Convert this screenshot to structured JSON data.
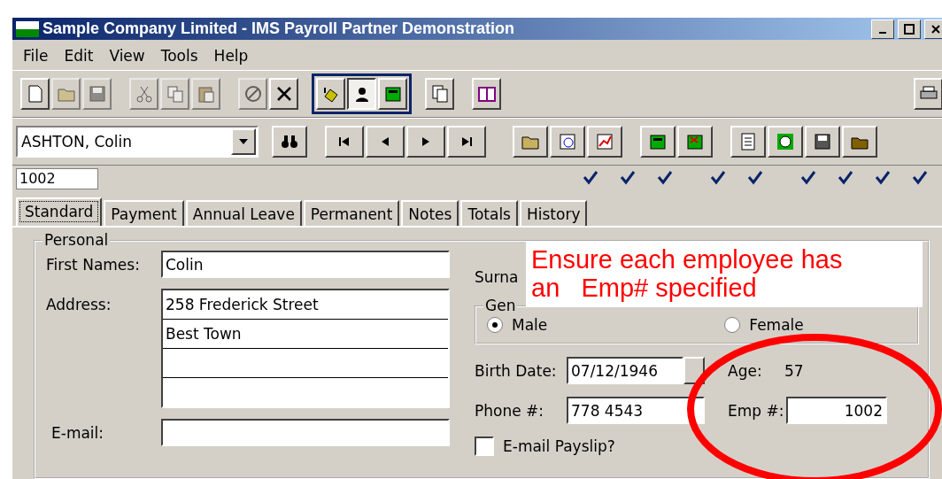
{
  "window": {
    "title": "Sample Company Limited - IMS Payroll Partner Demonstration"
  },
  "menu": [
    "File",
    "Edit",
    "View",
    "Tools",
    "Help"
  ],
  "toolbar": {
    "groups": [
      {
        "kind": "plain",
        "buttons": [
          {
            "disabled": false
          },
          {
            "disabled": true
          },
          {
            "disabled": true
          }
        ]
      },
      {
        "kind": "plain",
        "buttons": [
          {
            "disabled": true
          },
          {
            "disabled": true
          },
          {
            "disabled": true
          }
        ]
      },
      {
        "kind": "plain",
        "buttons": [
          {
            "disabled": true
          },
          {
            "disabled": false
          }
        ]
      },
      {
        "kind": "framed",
        "buttons": [
          {
            "pressed": false
          },
          {
            "pressed": true
          },
          {
            "pressed": false
          }
        ]
      },
      {
        "kind": "plain",
        "buttons": [
          {
            "disabled": false
          }
        ]
      },
      {
        "kind": "plain",
        "buttons": [
          {
            "disabled": false
          }
        ]
      },
      {
        "kind": "trailing",
        "buttons": [
          {
            "disabled": false
          }
        ]
      }
    ]
  },
  "employee_picker": {
    "value": "ASHTON, Colin"
  },
  "record_bar": {
    "groups": [
      {
        "buttons": [
          {
            "ticked": false
          }
        ]
      },
      {
        "buttons": [
          {
            "ticked": false
          },
          {
            "ticked": false
          },
          {
            "ticked": false
          },
          {
            "ticked": false
          }
        ]
      },
      {
        "buttons": [
          {
            "ticked": true
          },
          {
            "ticked": true
          },
          {
            "ticked": true
          }
        ]
      },
      {
        "buttons": [
          {
            "ticked": true
          },
          {
            "ticked": true
          }
        ]
      },
      {
        "buttons": [
          {
            "ticked": true
          },
          {
            "ticked": true
          },
          {
            "ticked": true
          },
          {
            "ticked": true
          }
        ]
      }
    ]
  },
  "employee_id": "1002",
  "tabs": [
    {
      "label": "Standard",
      "selected": true
    },
    {
      "label": "Payment",
      "selected": false
    },
    {
      "label": "Annual Leave",
      "selected": false
    },
    {
      "label": "Permanent",
      "selected": false
    },
    {
      "label": "Notes",
      "selected": false
    },
    {
      "label": "Totals",
      "selected": false
    },
    {
      "label": "History",
      "selected": false
    }
  ],
  "personal": {
    "legend": "Personal",
    "first_names": {
      "label": "First Names:",
      "value": "Colin"
    },
    "address": {
      "label": "Address:",
      "lines": [
        "258 Frederick Street",
        "Best Town"
      ]
    },
    "email": {
      "label": "E-mail:"
    },
    "surname": {
      "label": "Surna"
    },
    "gender": {
      "legend": "Gen",
      "options": [
        {
          "label": "Male",
          "selected": true
        },
        {
          "label": "Female",
          "selected": false
        }
      ]
    },
    "birth_date": {
      "label": "Birth Date:",
      "value": "07/12/1946"
    },
    "age": {
      "label": "Age:",
      "value": "57"
    },
    "phone": {
      "label": "Phone #:",
      "value": "778 4543"
    },
    "emp_no": {
      "label": "Emp #:",
      "value": "1002"
    },
    "email_payslip": {
      "label": "E-mail Payslip?",
      "checked": false
    }
  },
  "callout": {
    "text": "Ensure each employee has an   Emp# specified"
  }
}
